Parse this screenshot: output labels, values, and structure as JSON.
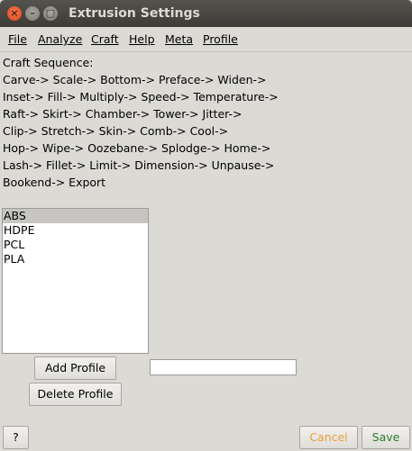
{
  "window": {
    "title": "Extrusion Settings"
  },
  "menu": [
    "File",
    "Analyze",
    "Craft",
    "Help",
    "Meta",
    "Profile"
  ],
  "craft_sequence": {
    "heading": "Craft Sequence:",
    "lines": [
      "Carve-> Scale-> Bottom-> Preface-> Widen->",
      "Inset-> Fill-> Multiply-> Speed-> Temperature->",
      "Raft-> Skirt-> Chamber-> Tower-> Jitter->",
      "Clip-> Stretch-> Skin-> Comb-> Cool->",
      "Hop-> Wipe-> Oozebane-> Splodge-> Home->",
      "Lash-> Fillet-> Limit-> Dimension-> Unpause->",
      "Bookend-> Export"
    ]
  },
  "profiles": {
    "items": [
      "ABS",
      "HDPE",
      "PCL",
      "PLA"
    ],
    "selected_index": 0
  },
  "buttons": {
    "add_profile": "Add Profile",
    "delete_profile": "Delete Profile",
    "help": "?",
    "cancel": "Cancel",
    "save": "Save"
  },
  "new_profile_field": {
    "value": ""
  },
  "colors": {
    "cancel_text": "#e8a13a",
    "save_text": "#2e7d2e",
    "selected_row": "#c6c5c1"
  }
}
